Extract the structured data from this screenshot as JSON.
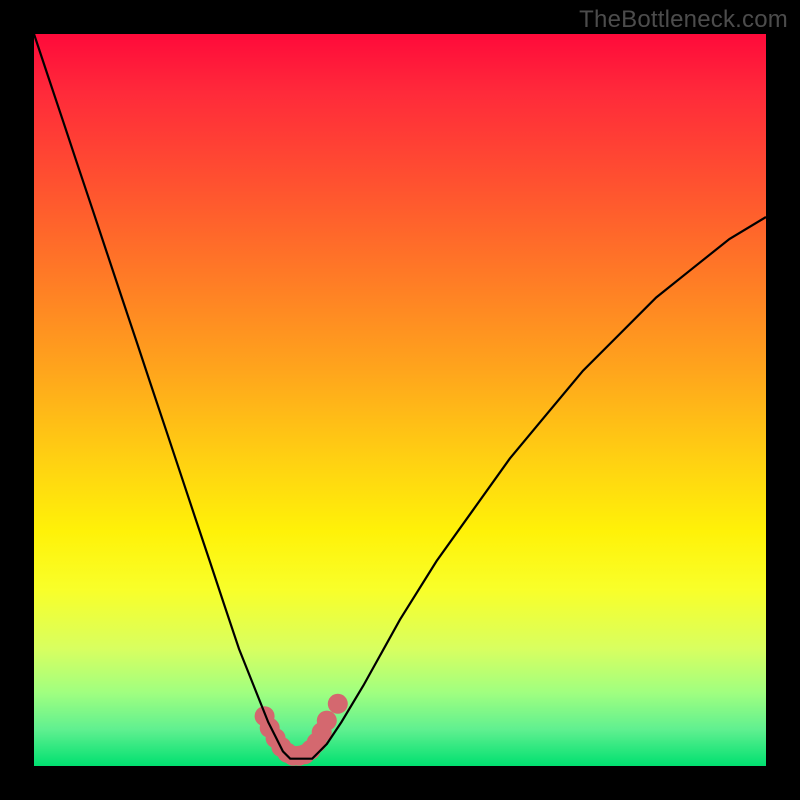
{
  "watermark": "TheBottleneck.com",
  "chart_data": {
    "type": "line",
    "title": "",
    "xlabel": "",
    "ylabel": "",
    "xlim": [
      0,
      100
    ],
    "ylim": [
      0,
      100
    ],
    "grid": false,
    "series": [
      {
        "name": "bottleneck-curve",
        "x": [
          0,
          2,
          4,
          6,
          8,
          10,
          12,
          14,
          16,
          18,
          20,
          22,
          24,
          26,
          28,
          30,
          32,
          33,
          34,
          35,
          36,
          37,
          38,
          39,
          40,
          42,
          45,
          50,
          55,
          60,
          65,
          70,
          75,
          80,
          85,
          90,
          95,
          100
        ],
        "y": [
          100,
          94,
          88,
          82,
          76,
          70,
          64,
          58,
          52,
          46,
          40,
          34,
          28,
          22,
          16,
          11,
          6,
          4,
          2,
          1,
          1,
          1,
          1,
          2,
          3,
          6,
          11,
          20,
          28,
          35,
          42,
          48,
          54,
          59,
          64,
          68,
          72,
          75
        ],
        "stroke": "#000000",
        "stroke_width": 2.2
      }
    ],
    "markers": {
      "name": "highlight-dots",
      "x": [
        31.5,
        32.2,
        33.0,
        33.8,
        34.6,
        35.4,
        36.2,
        37.0,
        37.8,
        38.6,
        39.3,
        40.0,
        41.5
      ],
      "y": [
        6.8,
        5.2,
        3.8,
        2.6,
        1.8,
        1.4,
        1.4,
        1.6,
        2.2,
        3.2,
        4.6,
        6.2,
        8.5
      ],
      "color": "#d4686f",
      "radius": 10
    }
  }
}
